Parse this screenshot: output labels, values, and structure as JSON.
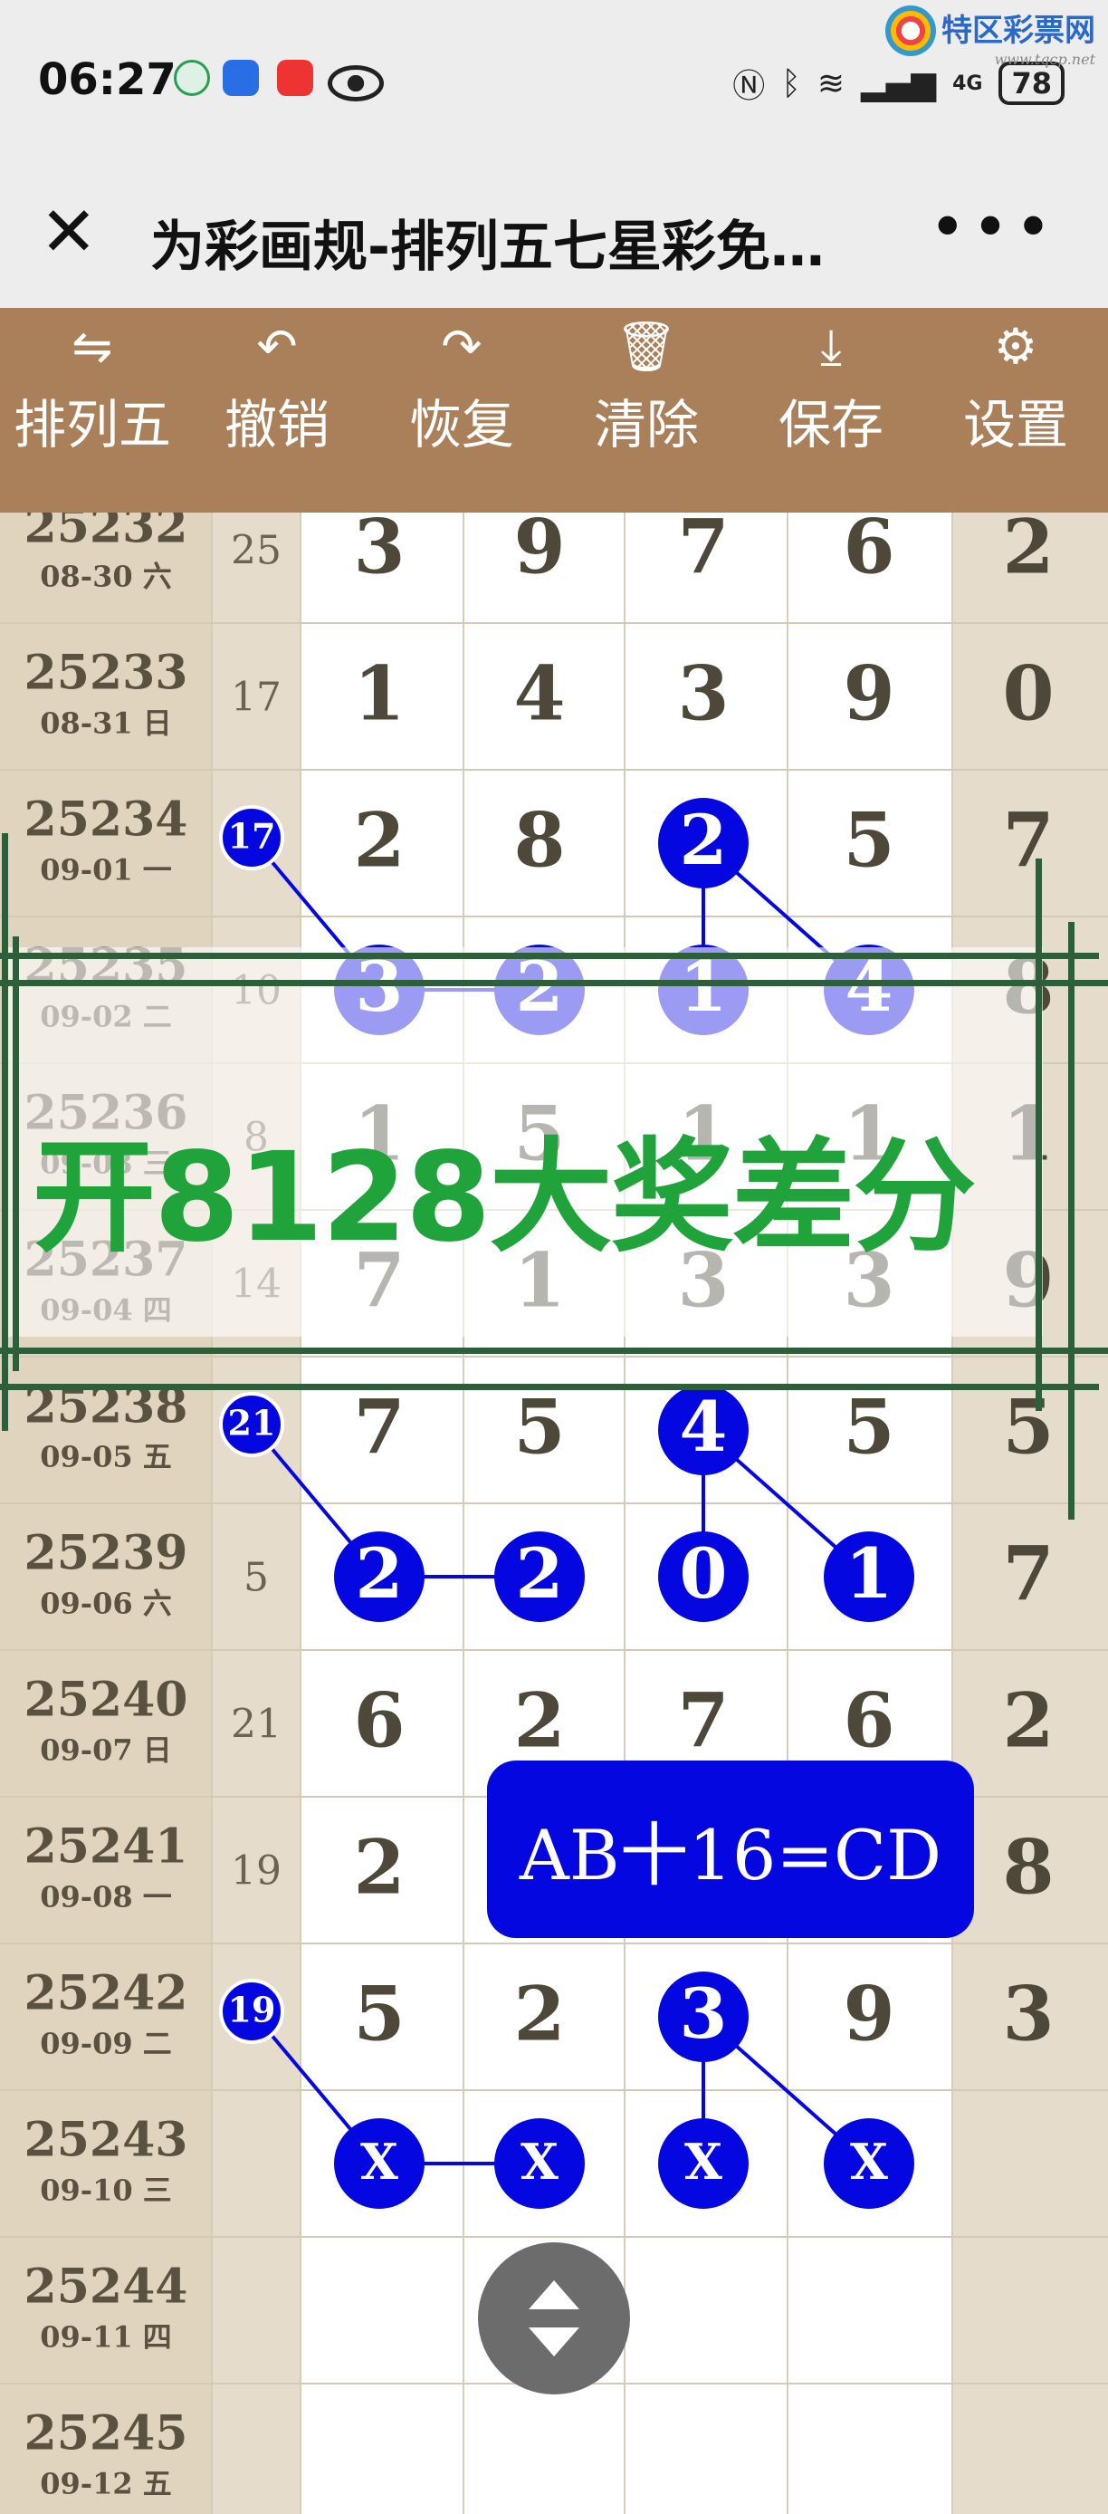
{
  "status_bar": {
    "time": "06:27",
    "battery": "78",
    "network": "4G"
  },
  "watermark": {
    "site_name": "特区彩票网",
    "url": "www.tqcp.net"
  },
  "titlebar": {
    "title": "为彩画规-排列五七星彩免…",
    "more_label": "•••"
  },
  "toolbar": {
    "items": [
      {
        "label": "排列五",
        "icon": "swap-icon"
      },
      {
        "label": "撤销",
        "icon": "undo-icon"
      },
      {
        "label": "恢复",
        "icon": "redo-icon"
      },
      {
        "label": "清除",
        "icon": "trash-icon"
      },
      {
        "label": "保存",
        "icon": "download-icon"
      },
      {
        "label": "设置",
        "icon": "gear-icon"
      }
    ]
  },
  "rows": [
    {
      "issue": "25232",
      "date": "08-30 六",
      "sum": "25",
      "d": [
        "3",
        "9",
        "7",
        "6"
      ],
      "last": "2"
    },
    {
      "issue": "25233",
      "date": "08-31 日",
      "sum": "17",
      "d": [
        "1",
        "4",
        "3",
        "9"
      ],
      "last": "0"
    },
    {
      "issue": "25234",
      "date": "09-01 一",
      "sum": "",
      "d": [
        "2",
        "8",
        "2",
        "5"
      ],
      "last": "7"
    },
    {
      "issue": "25235",
      "date": "09-02 二",
      "sum": "10",
      "d": [
        "3",
        "2",
        "1",
        "4"
      ],
      "last": "8"
    },
    {
      "issue": "25236",
      "date": "09-03 三",
      "sum": "8",
      "d": [
        "1",
        "5",
        "1",
        "1"
      ],
      "last": "1"
    },
    {
      "issue": "25237",
      "date": "09-04 四",
      "sum": "14",
      "d": [
        "7",
        "1",
        "3",
        "3"
      ],
      "last": "9"
    },
    {
      "issue": "25238",
      "date": "09-05 五",
      "sum": "",
      "d": [
        "7",
        "5",
        "4",
        "5"
      ],
      "last": "5"
    },
    {
      "issue": "25239",
      "date": "09-06 六",
      "sum": "5",
      "d": [
        "2",
        "2",
        "0",
        "1"
      ],
      "last": "7"
    },
    {
      "issue": "25240",
      "date": "09-07 日",
      "sum": "21",
      "d": [
        "6",
        "2",
        "7",
        "6"
      ],
      "last": "2"
    },
    {
      "issue": "25241",
      "date": "09-08 一",
      "sum": "19",
      "d": [
        "2",
        "",
        "",
        ""
      ],
      "last": "8"
    },
    {
      "issue": "25242",
      "date": "09-09 二",
      "sum": "",
      "d": [
        "5",
        "2",
        "3",
        "9"
      ],
      "last": "3"
    },
    {
      "issue": "25243",
      "date": "09-10 三",
      "sum": "",
      "d": [
        "X",
        "X",
        "X",
        "X"
      ],
      "last": ""
    },
    {
      "issue": "25244",
      "date": "09-11 四",
      "sum": "",
      "d": [
        "",
        "",
        "",
        ""
      ],
      "last": ""
    },
    {
      "issue": "25245",
      "date": "09-12 五",
      "sum": "",
      "d": [
        "",
        "",
        "",
        ""
      ],
      "last": ""
    }
  ],
  "markers": [
    {
      "label": "17",
      "row": 2
    },
    {
      "label": "21",
      "row": 6
    },
    {
      "label": "19",
      "row": 10
    }
  ],
  "highlights": [
    {
      "row": 2,
      "col": 2
    },
    {
      "row": 3,
      "col": 0
    },
    {
      "row": 3,
      "col": 1
    },
    {
      "row": 3,
      "col": 2
    },
    {
      "row": 3,
      "col": 3
    },
    {
      "row": 6,
      "col": 2
    },
    {
      "row": 7,
      "col": 0
    },
    {
      "row": 7,
      "col": 1
    },
    {
      "row": 7,
      "col": 2
    },
    {
      "row": 7,
      "col": 3
    },
    {
      "row": 10,
      "col": 2
    },
    {
      "row": 11,
      "col": 0
    },
    {
      "row": 11,
      "col": 1
    },
    {
      "row": 11,
      "col": 2
    },
    {
      "row": 11,
      "col": 3
    }
  ],
  "overlay": {
    "banner_text": "开8128大奖差分",
    "formula": "AB十16=CD"
  },
  "colors": {
    "toolbar_bg": "#a9805a",
    "ball_blue": "#0507e0",
    "banner_green": "#21a33b",
    "grid_dark_line": "#2f5e3b",
    "column_bg": "#e6dccb"
  }
}
